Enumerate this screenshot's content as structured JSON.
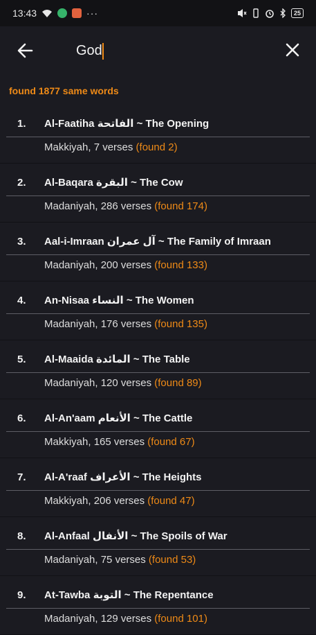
{
  "status_bar": {
    "time": "13:43",
    "more": "···",
    "battery": "25"
  },
  "app_bar": {
    "search_value": "God"
  },
  "results": {
    "summary": "found 1877 same words"
  },
  "chapters": [
    {
      "num": "1.",
      "title": "Al-Faatiha الفاتحة ~ The Opening",
      "info": "Makkiyah, 7 verses ",
      "found": "(found 2)"
    },
    {
      "num": "2.",
      "title": "Al-Baqara البقرة ~ The Cow",
      "info": "Madaniyah, 286 verses ",
      "found": "(found 174)"
    },
    {
      "num": "3.",
      "title": "Aal-i-Imraan آل عمران ~ The Family of Imraan",
      "info": "Madaniyah, 200 verses ",
      "found": "(found 133)"
    },
    {
      "num": "4.",
      "title": "An-Nisaa النساء ~ The Women",
      "info": "Madaniyah, 176 verses ",
      "found": "(found 135)"
    },
    {
      "num": "5.",
      "title": "Al-Maaida المائدة ~ The Table",
      "info": "Madaniyah, 120 verses ",
      "found": "(found 89)"
    },
    {
      "num": "6.",
      "title": "Al-An'aam الأنعام ~ The Cattle",
      "info": "Makkiyah, 165 verses ",
      "found": "(found 67)"
    },
    {
      "num": "7.",
      "title": "Al-A'raaf الأعراف ~ The Heights",
      "info": "Makkiyah, 206 verses ",
      "found": "(found 47)"
    },
    {
      "num": "8.",
      "title": "Al-Anfaal الأنفال ~ The Spoils of War",
      "info": "Madaniyah, 75 verses ",
      "found": "(found 53)"
    },
    {
      "num": "9.",
      "title": "At-Tawba التوبة ~ The Repentance",
      "info": "Madaniyah, 129 verses ",
      "found": "(found 101)"
    }
  ],
  "colors": {
    "accent": "#ee8a17",
    "background": "#1b1b21"
  }
}
